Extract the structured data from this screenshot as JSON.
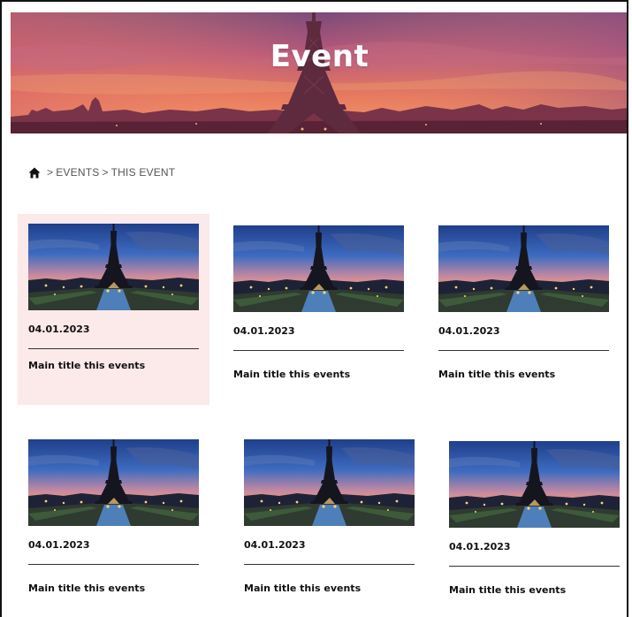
{
  "hero": {
    "title": "Event"
  },
  "breadcrumb": {
    "icon": "home-icon",
    "separator": ">",
    "items": [
      "EVENTS",
      "THIS EVENT"
    ]
  },
  "colors": {
    "featured_card_bg": "#fce9ea",
    "hero_sky_top": "#8a4a78",
    "hero_sky_bottom": "#e8845a"
  },
  "events": [
    {
      "date": "04.01.2023",
      "title": "Main title this events",
      "featured": true,
      "image": "eiffel-tower-sunset-photo"
    },
    {
      "date": "04.01.2023",
      "title": "Main title this events",
      "featured": false,
      "image": "eiffel-tower-sunset-photo"
    },
    {
      "date": "04.01.2023",
      "title": "Main title this events",
      "featured": false,
      "image": "eiffel-tower-sunset-photo"
    },
    {
      "date": "04.01.2023",
      "title": "Main title this events",
      "featured": false,
      "image": "eiffel-tower-sunset-photo"
    },
    {
      "date": "04.01.2023",
      "title": "Main title this events",
      "featured": false,
      "image": "eiffel-tower-sunset-photo"
    },
    {
      "date": "04.01.2023",
      "title": "Main title this events",
      "featured": false,
      "image": "eiffel-tower-sunset-photo"
    }
  ]
}
